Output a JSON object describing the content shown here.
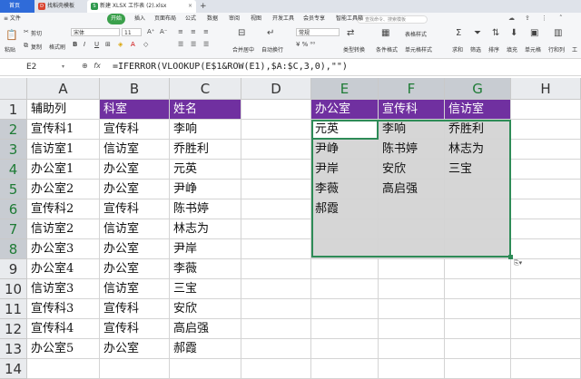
{
  "tabs": {
    "home": "首页",
    "templates": "找稻壳模板",
    "file": "新建 XLSX 工作表 (2).xlsx",
    "file_icon": "S",
    "templates_icon": "D",
    "close": "×",
    "add": "+"
  },
  "menu": {
    "items": [
      "≡ 文件",
      "开始",
      "插入",
      "页面布局",
      "公式",
      "数据",
      "审阅",
      "视图",
      "开发工具",
      "会员专享",
      "智能工具箱"
    ],
    "active_index": 1,
    "search_placeholder": "查找命令、搜索模板",
    "search_icon": "search-icon"
  },
  "ribbon": {
    "paste": "粘贴",
    "cut": "剪切",
    "copy": "复制",
    "format_painter": "格式刷",
    "font_name": "宋体",
    "font_size": "11",
    "merge": "合并居中",
    "wrap": "自动换行",
    "number_format": "常规",
    "type_convert": "类型转换",
    "conditional_format": "条件格式",
    "table_style": "表格样式",
    "cell_style": "单元格样式",
    "sum": "求和",
    "filter": "筛选",
    "sort": "排序",
    "fill": "填充",
    "single_cell": "单元格",
    "row_col": "行和列",
    "worksheet": "工"
  },
  "formula_bar": {
    "cell_ref": "E2",
    "fx": "fx",
    "formula": "=IFERROR(VLOOKUP(E$1&ROW(E1),$A:$C,3,0),\"\")"
  },
  "columns": [
    "A",
    "B",
    "C",
    "D",
    "E",
    "F",
    "G",
    "H"
  ],
  "rows": [
    "1",
    "2",
    "3",
    "4",
    "5",
    "6",
    "7",
    "8",
    "9",
    "10",
    "11",
    "12",
    "13",
    "14"
  ],
  "selected_columns": [
    "E",
    "F",
    "G"
  ],
  "selected_rows": [
    "2",
    "3",
    "4",
    "5",
    "6",
    "7",
    "8"
  ],
  "grid": {
    "r1": [
      "辅助列",
      "科室",
      "姓名",
      "",
      "办公室",
      "宣传科",
      "信访室",
      ""
    ],
    "r2": [
      "宣传科1",
      "宣传科",
      "李响",
      "",
      "元英",
      "李响",
      "乔胜利",
      ""
    ],
    "r3": [
      "信访室1",
      "信访室",
      "乔胜利",
      "",
      "尹峥",
      "陈书婷",
      "林志为",
      ""
    ],
    "r4": [
      "办公室1",
      "办公室",
      "元英",
      "",
      "尹岸",
      "安欣",
      "三宝",
      ""
    ],
    "r5": [
      "办公室2",
      "办公室",
      "尹峥",
      "",
      "李薇",
      "高启强",
      "",
      ""
    ],
    "r6": [
      "宣传科2",
      "宣传科",
      "陈书婷",
      "",
      "郝霞",
      "",
      "",
      ""
    ],
    "r7": [
      "信访室2",
      "信访室",
      "林志为",
      "",
      "",
      "",
      "",
      ""
    ],
    "r8": [
      "办公室3",
      "办公室",
      "尹岸",
      "",
      "",
      "",
      "",
      ""
    ],
    "r9": [
      "办公室4",
      "办公室",
      "李薇",
      "",
      "",
      "",
      "",
      ""
    ],
    "r10": [
      "信访室3",
      "信访室",
      "三宝",
      "",
      "",
      "",
      "",
      ""
    ],
    "r11": [
      "宣传科3",
      "宣传科",
      "安欣",
      "",
      "",
      "",
      "",
      ""
    ],
    "r12": [
      "宣传科4",
      "宣传科",
      "高启强",
      "",
      "",
      "",
      "",
      ""
    ],
    "r13": [
      "办公室5",
      "办公室",
      "郝霞",
      "",
      "",
      "",
      "",
      ""
    ],
    "r14": [
      "",
      "",
      "",
      "",
      "",
      "",
      "",
      ""
    ]
  },
  "colors": {
    "header_fill": "#7030a0",
    "selection_border": "#2e8b57",
    "selection_fill": "#d6d6d6",
    "menu_active": "#3aa04b"
  }
}
